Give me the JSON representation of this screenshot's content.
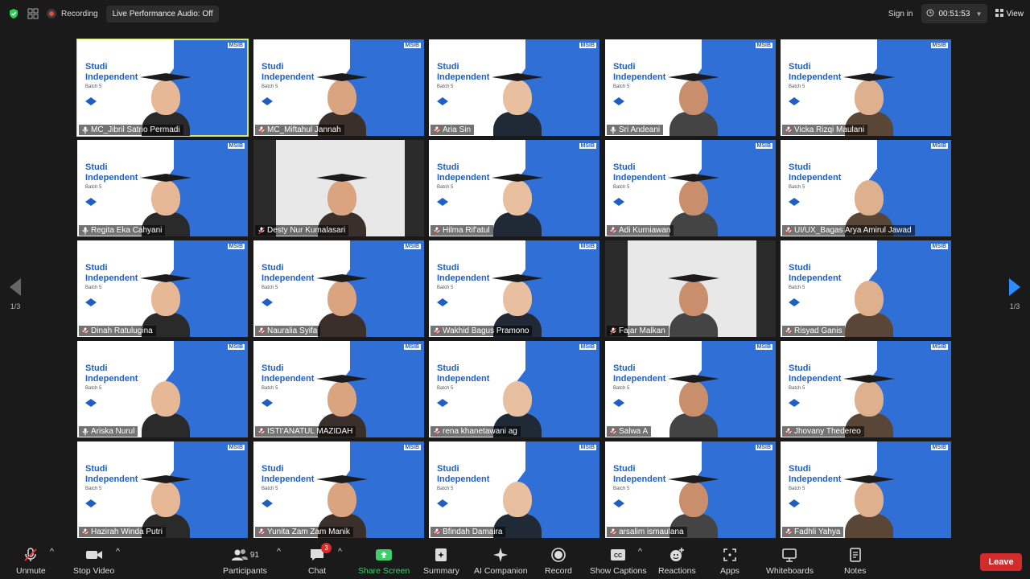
{
  "topbar": {
    "recording_label": "Recording",
    "audio_pill": "Live Performance Audio: Off",
    "signin": "Sign in",
    "timer": "00:51:53",
    "view": "View"
  },
  "nav": {
    "left_page": "1/3",
    "right_page": "1/3"
  },
  "tile_text": {
    "studi": "Studi",
    "independent": "Independent",
    "batch": "Batch 5",
    "msib": "MSIB"
  },
  "participants": [
    {
      "name": "MC_Jibril Satrio Permadi",
      "active": true,
      "muted": false
    },
    {
      "name": "MC_Miftahul Jannah",
      "muted": true
    },
    {
      "name": "Aria Sin",
      "muted": true
    },
    {
      "name": "Sri Andeani",
      "muted": false
    },
    {
      "name": "Vicka Rizqi Maulani",
      "muted": true
    },
    {
      "name": "Regita Eka Cahyani",
      "muted": false
    },
    {
      "name": "Desty Nur Kumalasari",
      "muted": true
    },
    {
      "name": "Hilma Rif'atul",
      "muted": true
    },
    {
      "name": "Adi Kurniawan",
      "muted": true
    },
    {
      "name": "UI/UX_Bagas Arya Amirul Jawad",
      "muted": true
    },
    {
      "name": "Dinah Ratulugina",
      "muted": true
    },
    {
      "name": "Nauralia Syifa",
      "muted": true
    },
    {
      "name": "Wakhid Bagus Pramono",
      "muted": true
    },
    {
      "name": "Fajar Malkan",
      "muted": true
    },
    {
      "name": "Risyad Ganis",
      "muted": true
    },
    {
      "name": "Ariska Nurul",
      "muted": false
    },
    {
      "name": "ISTI'ANATUL MAZIDAH",
      "muted": true
    },
    {
      "name": "rena khanetawani ag",
      "muted": true
    },
    {
      "name": "Salwa A",
      "muted": true
    },
    {
      "name": "Jhovany Thedereo",
      "muted": true
    },
    {
      "name": "Hazirah Winda Putri",
      "muted": true
    },
    {
      "name": "Yunita Zam Zam Manik",
      "muted": true
    },
    {
      "name": "Bfindah Damaira",
      "muted": true
    },
    {
      "name": "arsalim ismaulana",
      "muted": true
    },
    {
      "name": "Fadhli Yahya",
      "muted": true
    }
  ],
  "toolbar": {
    "unmute": "Unmute",
    "stop_video": "Stop Video",
    "participants": "Participants",
    "participants_count": "91",
    "chat": "Chat",
    "chat_badge": "3",
    "share_screen": "Share Screen",
    "summary": "Summary",
    "ai_companion": "AI Companion",
    "record": "Record",
    "show_captions": "Show Captions",
    "reactions": "Reactions",
    "apps": "Apps",
    "whiteboards": "Whiteboards",
    "notes": "Notes",
    "leave": "Leave"
  },
  "colors": {
    "accent_green": "#3fcf6a",
    "leave_red": "#d12b2b",
    "brand_blue": "#2f6fd6",
    "active_speaker": "#d6e86a"
  }
}
